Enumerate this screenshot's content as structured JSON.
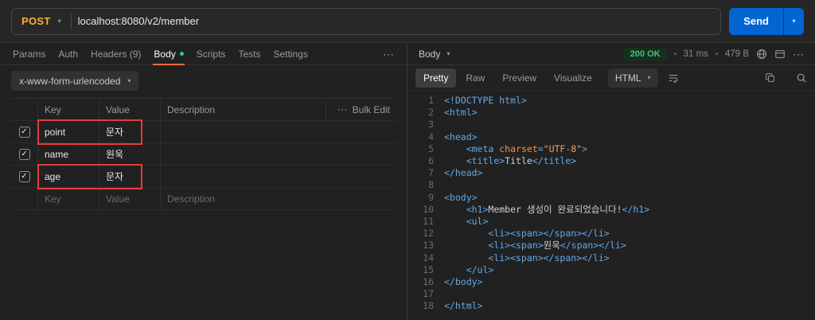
{
  "request": {
    "method": "POST",
    "url": "localhost:8080/v2/member",
    "send_label": "Send",
    "tabs": [
      {
        "label": "Params"
      },
      {
        "label": "Auth"
      },
      {
        "label": "Headers (9)"
      },
      {
        "label": "Body"
      },
      {
        "label": "Scripts"
      },
      {
        "label": "Tests"
      },
      {
        "label": "Settings"
      }
    ],
    "active_tab": "Body",
    "body_type": "x-www-form-urlencoded"
  },
  "kv_table": {
    "columns": {
      "key": "Key",
      "value": "Value",
      "description": "Description"
    },
    "bulk_edit_label": "Bulk Edit",
    "rows": [
      {
        "key": "point",
        "value": "문자",
        "description": "",
        "checked": true,
        "highlighted": true
      },
      {
        "key": "name",
        "value": "원욱",
        "description": "",
        "checked": true,
        "highlighted": false
      },
      {
        "key": "age",
        "value": "문자",
        "description": "",
        "checked": true,
        "highlighted": true
      }
    ],
    "placeholder": {
      "key": "Key",
      "value": "Value",
      "description": "Description"
    }
  },
  "response": {
    "pane_label": "Body",
    "status": "200 OK",
    "time": "31 ms",
    "size": "479 B",
    "views": [
      {
        "label": "Pretty"
      },
      {
        "label": "Raw"
      },
      {
        "label": "Preview"
      },
      {
        "label": "Visualize"
      }
    ],
    "active_view": "Pretty",
    "language": "HTML"
  },
  "code": {
    "lines": [
      {
        "n": "1",
        "tokens": [
          [
            "t",
            "<!DOCTYPE html>"
          ]
        ]
      },
      {
        "n": "2",
        "tokens": [
          [
            "t",
            "<html>"
          ]
        ]
      },
      {
        "n": "3",
        "tokens": []
      },
      {
        "n": "4",
        "tokens": [
          [
            "t",
            "<head>"
          ]
        ]
      },
      {
        "n": "5",
        "tokens": [
          [
            "x",
            "    "
          ],
          [
            "t",
            "<meta "
          ],
          [
            "a",
            "charset"
          ],
          [
            "t",
            "="
          ],
          [
            "s",
            "\"UTF-8\""
          ],
          [
            "t",
            ">"
          ]
        ]
      },
      {
        "n": "6",
        "tokens": [
          [
            "x",
            "    "
          ],
          [
            "t",
            "<title>"
          ],
          [
            "x",
            "Title"
          ],
          [
            "t",
            "</title>"
          ]
        ]
      },
      {
        "n": "7",
        "tokens": [
          [
            "t",
            "</head>"
          ]
        ]
      },
      {
        "n": "8",
        "tokens": []
      },
      {
        "n": "9",
        "tokens": [
          [
            "t",
            "<body>"
          ]
        ]
      },
      {
        "n": "10",
        "tokens": [
          [
            "x",
            "    "
          ],
          [
            "t",
            "<h1>"
          ],
          [
            "x",
            "Member 생성이 완료되었습니다!"
          ],
          [
            "t",
            "</h1>"
          ]
        ]
      },
      {
        "n": "11",
        "tokens": [
          [
            "x",
            "    "
          ],
          [
            "t",
            "<ul>"
          ]
        ]
      },
      {
        "n": "12",
        "tokens": [
          [
            "x",
            "        "
          ],
          [
            "t",
            "<li><span></span></li>"
          ]
        ]
      },
      {
        "n": "13",
        "tokens": [
          [
            "x",
            "        "
          ],
          [
            "t",
            "<li><span>"
          ],
          [
            "x",
            "원욱"
          ],
          [
            "t",
            "</span></li>"
          ]
        ]
      },
      {
        "n": "14",
        "tokens": [
          [
            "x",
            "        "
          ],
          [
            "t",
            "<li><span></span></li>"
          ]
        ]
      },
      {
        "n": "15",
        "tokens": [
          [
            "x",
            "    "
          ],
          [
            "t",
            "</ul>"
          ]
        ]
      },
      {
        "n": "16",
        "tokens": [
          [
            "t",
            "</body>"
          ]
        ]
      },
      {
        "n": "17",
        "tokens": []
      },
      {
        "n": "18",
        "tokens": [
          [
            "t",
            "</html>"
          ]
        ]
      }
    ]
  },
  "colors": {
    "method_post": "#ffb02e",
    "send_button": "#0265d2",
    "status_success": "#4dbd7f",
    "status_success_bg": "#15301f",
    "annotation_red": "#e23c3c",
    "tab_active_underline": "#ff6c37",
    "body_dot_green": "#2fd371",
    "code_tag": "#62a8e8",
    "code_attr": "#f98e48",
    "code_string": "#e8a06a",
    "code_text": "#d0d0d0"
  }
}
